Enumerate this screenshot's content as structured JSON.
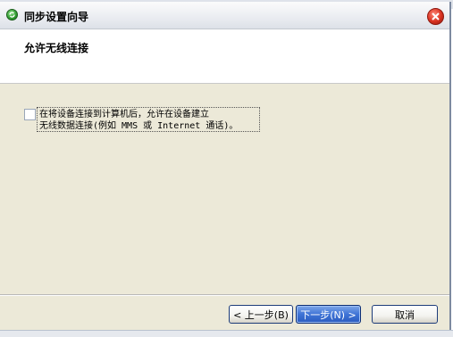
{
  "window": {
    "title": "同步设置向导"
  },
  "header": {
    "title": "允许无线连接"
  },
  "option": {
    "label_line1": "在将设备连接到计算机后，允许在设备建立",
    "label_line2": "无线数据连接(例如 MMS 或 Internet 通话)。",
    "checked": false
  },
  "buttons": {
    "back_label": "< 上一步(B)",
    "next_label": "下一步(N) >",
    "cancel_label": "取消"
  },
  "icons": {
    "app": "sync-wizard-icon",
    "close": "close-icon"
  },
  "colors": {
    "dialog_bg": "#ece9d8",
    "next_button": "#3f74d6",
    "close_button": "#d8301f"
  }
}
